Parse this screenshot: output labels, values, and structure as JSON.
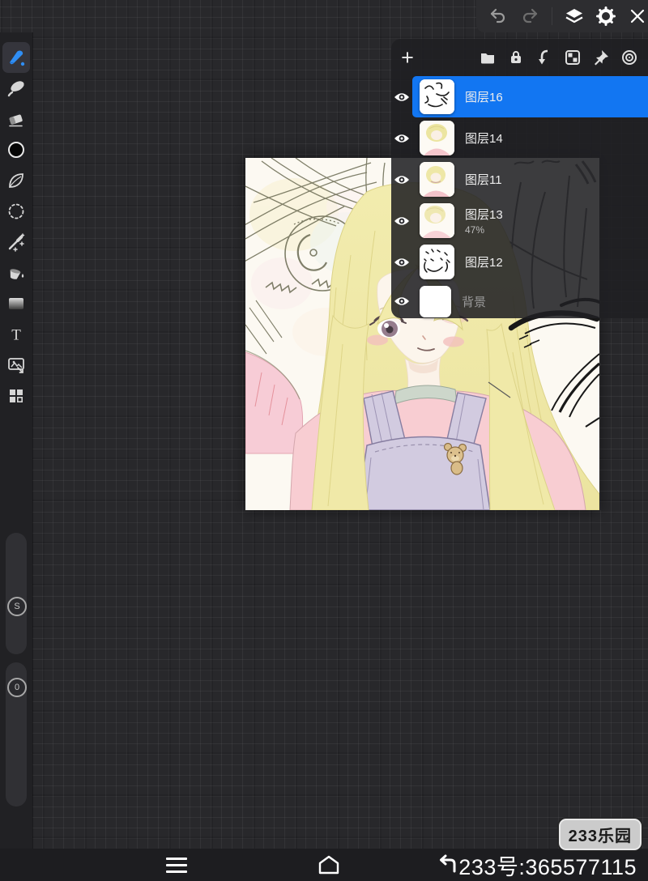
{
  "colors": {
    "accent_blue": "#1276f2",
    "tool_blue": "#2f8ef4",
    "panel_bg": "#1f1f22",
    "canvas_bg": "#fcf9f2",
    "badge_bg": "#cbcbcb"
  },
  "top_toolbar": {
    "icons": [
      "undo-icon",
      "redo-icon",
      "layers-icon",
      "settings-gear-icon",
      "close-icon"
    ]
  },
  "left_toolbar": {
    "tools": [
      "brush",
      "smudge",
      "eraser",
      "color-swatch",
      "shape-leaf",
      "lasso-select",
      "magic-wand",
      "fill-bucket",
      "gradient",
      "text",
      "image-import",
      "canvas-grid"
    ],
    "selected_tool": "brush",
    "text_tool_glyph": "T",
    "size_slider_label": "S",
    "opacity_slider_label": "0"
  },
  "layers_panel": {
    "add_button": "+",
    "header_icons": [
      "folder-icon",
      "lock-icon",
      "merge-down-icon",
      "checkerboard-icon",
      "pin-icon",
      "target-icon"
    ],
    "layers": [
      {
        "name": "图层16",
        "selected": true,
        "thumbnail": "handwriting-scribbles"
      },
      {
        "name": "图层14",
        "thumbnail": "girl-painting"
      },
      {
        "name": "图层11",
        "thumbnail": "girl-painting"
      },
      {
        "name": "图层13",
        "opacity": "47%",
        "thumbnail": "girl-painting-faded"
      },
      {
        "name": "图层12",
        "thumbnail": "line-sketch"
      },
      {
        "name": "背景",
        "thumbnail": "white"
      }
    ]
  },
  "canvas": {
    "artwork": "anime-girl-pastel-painting"
  },
  "bottom_bar": {
    "nav_icons": [
      "menu-icon",
      "home-icon",
      "back-icon"
    ],
    "user_id": "233号:365577115"
  },
  "watermark": "233乐园"
}
